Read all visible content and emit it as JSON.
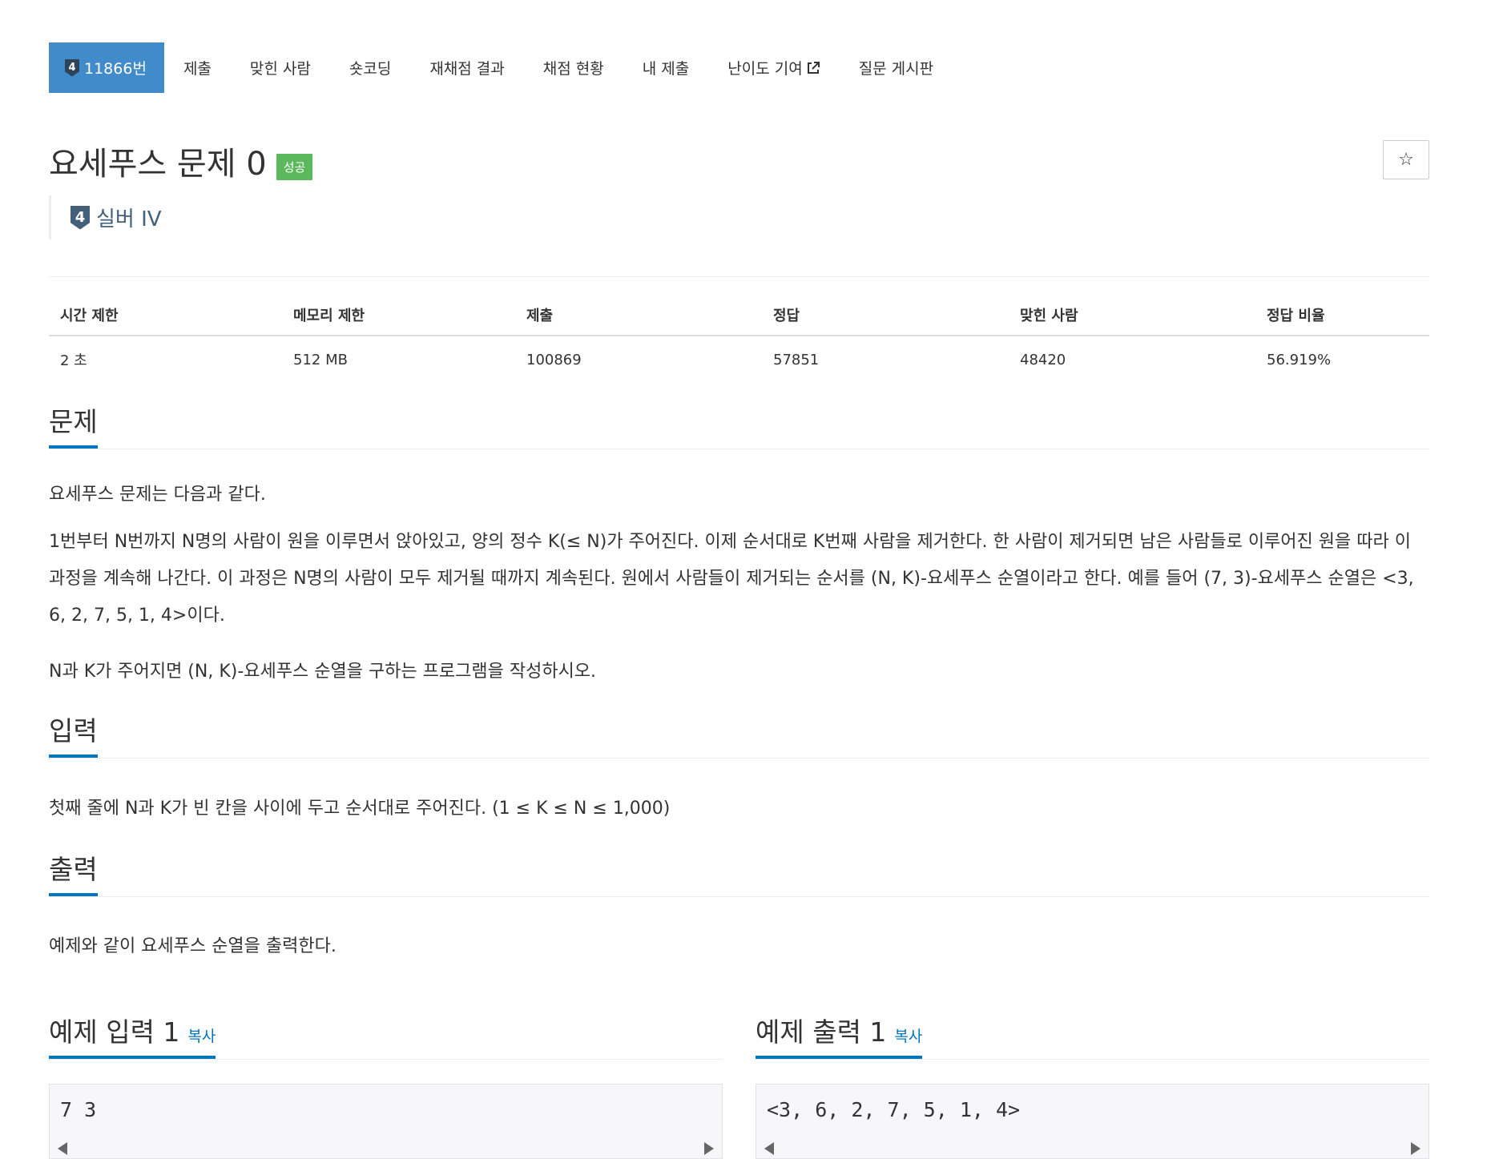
{
  "nav": {
    "problem_tier_badge": "4",
    "problem_number": "11866번",
    "items": [
      "제출",
      "맞힌 사람",
      "숏코딩",
      "재채점 결과",
      "채점 현황",
      "내 제출",
      "난이도 기여",
      "질문 게시판"
    ]
  },
  "problem": {
    "title": "요세푸스 문제 0",
    "result_badge": "성공",
    "star_button_icon": "☆",
    "tier_badge": "4",
    "tier_label": "실버 IV"
  },
  "stats": {
    "headers": [
      "시간 제한",
      "메모리 제한",
      "제출",
      "정답",
      "맞힌 사람",
      "정답 비율"
    ],
    "values": [
      "2 초",
      "512 MB",
      "100869",
      "57851",
      "48420",
      "56.919%"
    ]
  },
  "sections": {
    "description": {
      "heading": "문제",
      "paragraphs": [
        "요세푸스 문제는 다음과 같다.",
        "1번부터 N번까지 N명의 사람이 원을 이루면서 앉아있고, 양의 정수 K(≤ N)가 주어진다. 이제 순서대로 K번째 사람을 제거한다. 한 사람이 제거되면 남은 사람들로 이루어진 원을 따라 이 과정을 계속해 나간다. 이 과정은 N명의 사람이 모두 제거될 때까지 계속된다. 원에서 사람들이 제거되는 순서를 (N, K)-요세푸스 순열이라고 한다. 예를 들어 (7, 3)-요세푸스 순열은 <3, 6, 2, 7, 5, 1, 4>이다.",
        "N과 K가 주어지면 (N, K)-요세푸스 순열을 구하는 프로그램을 작성하시오."
      ]
    },
    "input": {
      "heading": "입력",
      "text": "첫째 줄에 N과 K가 빈 칸을 사이에 두고 순서대로 주어진다. (1 ≤ K ≤ N ≤ 1,000)"
    },
    "output": {
      "heading": "출력",
      "text": "예제와 같이 요세푸스 순열을 출력한다."
    }
  },
  "samples": {
    "input": {
      "heading": "예제 입력 1",
      "copy_label": "복사",
      "content": "7 3"
    },
    "output": {
      "heading": "예제 출력 1",
      "copy_label": "복사",
      "content": "<3, 6, 2, 7, 5, 1, 4>"
    }
  },
  "colors": {
    "nav_active": "#428bca",
    "success_badge": "#5cb85c",
    "link_blue": "#0076c0",
    "tier_silver": "#435f7a"
  }
}
